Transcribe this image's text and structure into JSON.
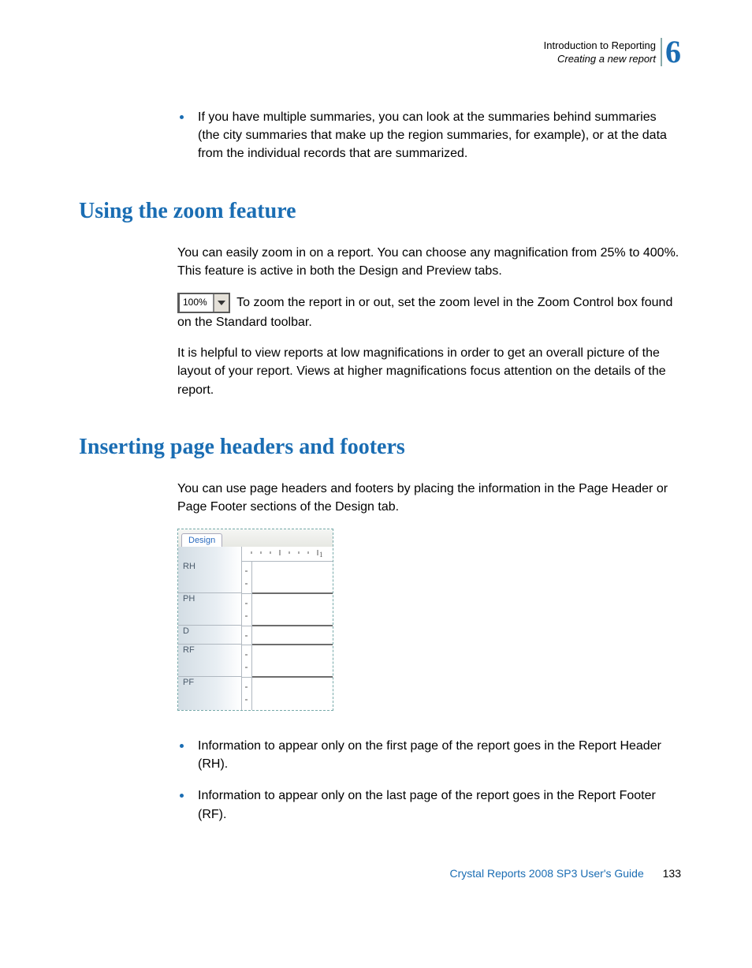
{
  "header": {
    "line1": "Introduction to Reporting",
    "line2": "Creating a new report",
    "chapter_number": "6"
  },
  "intro_bullets": [
    "If you have multiple summaries, you can look at the summaries behind summaries (the city summaries that make up the region summaries, for example), or at the data from the individual records that are summarized."
  ],
  "sections": {
    "zoom": {
      "title": "Using the zoom feature",
      "p1": "You can easily zoom in on a report. You can choose any magnification from 25% to 400%. This feature is active in both the Design and Preview tabs.",
      "zoom_value": "100%",
      "p2": " To zoom the report in or out, set the zoom level in the Zoom Control box found on the Standard toolbar.",
      "p3": "It is helpful to view reports at low magnifications in order to get an overall picture of the layout of your report. Views at higher magnifications focus attention on the details of the report."
    },
    "headers_footers": {
      "title": "Inserting page headers and footers",
      "p1": "You can use page headers and footers by placing the information in the Page Header or Page Footer sections of the Design tab.",
      "design_tab_label": "Design",
      "section_labels": {
        "rh": "RH",
        "ph": "PH",
        "d": "D",
        "rf": "RF",
        "pf": "PF"
      },
      "bullets": [
        "Information to appear only on the first page of the report goes in the Report Header (RH).",
        "Information to appear only on the last page of the report goes in the Report Footer (RF)."
      ]
    }
  },
  "footer": {
    "guide": "Crystal Reports 2008 SP3 User's Guide",
    "page": "133"
  }
}
